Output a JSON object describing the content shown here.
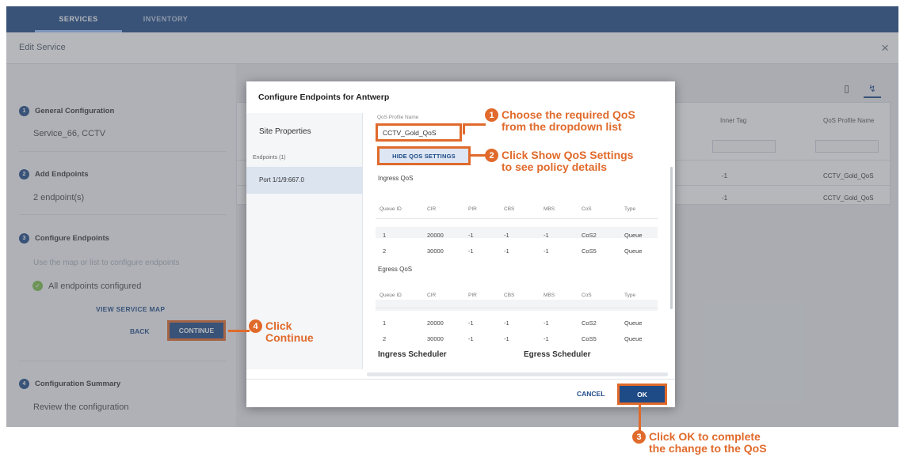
{
  "tabs": [
    {
      "label": "SERVICES",
      "active": true
    },
    {
      "label": "INVENTORY",
      "active": false
    }
  ],
  "header": {
    "title": "Edit Service",
    "close_icon": "close-icon"
  },
  "steps": {
    "general": {
      "number": "1",
      "title": "General Configuration",
      "detail": "Service_66, CCTV"
    },
    "endpoints": {
      "number": "2",
      "title": "Add Endpoints",
      "detail": "2 endpoint(s)"
    },
    "configure": {
      "number": "3",
      "title": "Configure Endpoints",
      "hint": "Use the map or list to configure endpoints",
      "status": "All endpoints configured",
      "view_map": "VIEW SERVICE MAP",
      "back": "BACK",
      "continue": "CONTINUE"
    },
    "summary": {
      "number": "4",
      "title": "Configuration Summary",
      "detail": "Review the configuration"
    }
  },
  "background_table": {
    "columns": [
      "Inner Tag",
      "QoS Profile Name"
    ],
    "rows": [
      [
        "-1",
        "CCTV_Gold_QoS"
      ],
      [
        "-1",
        "CCTV_Gold_QoS"
      ]
    ]
  },
  "modal": {
    "title": "Configure Endpoints for Antwerp",
    "site_properties": "Site Properties",
    "endpoints_label": "Endpoints (1)",
    "port": "Port 1/1/9:667.0",
    "qos_profile_label": "QoS Profile Name",
    "qos_profile_value": "CCTV_Gold_QoS",
    "hide_qos_button": "HIDE QOS SETTINGS",
    "ingress_title": "Ingress QoS",
    "egress_title": "Egress QoS",
    "columns": [
      "Queue ID",
      "CIR",
      "PIR",
      "CBS",
      "MBS",
      "CoS",
      "Type"
    ],
    "ingress_rows": [
      [
        "1",
        "20000",
        "-1",
        "-1",
        "-1",
        "CoS2",
        "Queue"
      ],
      [
        "2",
        "30000",
        "-1",
        "-1",
        "-1",
        "CoS5",
        "Queue"
      ]
    ],
    "egress_rows": [
      [
        "1",
        "20000",
        "-1",
        "-1",
        "-1",
        "CoS2",
        "Queue"
      ],
      [
        "2",
        "30000",
        "-1",
        "-1",
        "-1",
        "CoS5",
        "Queue"
      ]
    ],
    "ingress_scheduler": "Ingress Scheduler",
    "egress_scheduler": "Egress Scheduler",
    "cancel": "CANCEL",
    "ok": "OK"
  },
  "callouts": {
    "c1": {
      "number": "1",
      "line1": "Choose the required QoS",
      "line2": "from the dropdown list"
    },
    "c2": {
      "number": "2",
      "line1": "Click Show QoS Settings",
      "line2": "to see policy details"
    },
    "c3": {
      "number": "3",
      "line1": "Click OK to complete",
      "line2": "the change to the QoS"
    },
    "c4": {
      "number": "4",
      "line1": "Click",
      "line2": "Continue"
    }
  },
  "colors": {
    "primary": "#1e4a86",
    "accent": "#e06a2b",
    "success": "#7cbf4a"
  }
}
